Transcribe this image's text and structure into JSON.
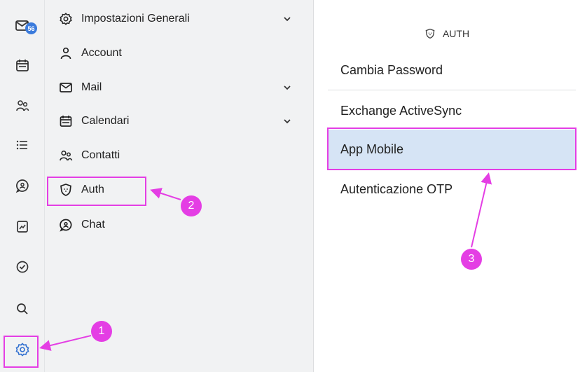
{
  "rail": {
    "badge_count": "56",
    "icons": [
      "mail-icon",
      "calendar-icon",
      "contacts-icon",
      "list-icon",
      "chat-icon",
      "files-icon",
      "tasks-icon",
      "search-icon",
      "settings-icon"
    ]
  },
  "menu": {
    "items": [
      {
        "label": "Impostazioni Generali",
        "icon": "gear-icon",
        "expandable": true
      },
      {
        "label": "Account",
        "icon": "person-icon",
        "expandable": false
      },
      {
        "label": "Mail",
        "icon": "mail-icon",
        "expandable": true
      },
      {
        "label": "Calendari",
        "icon": "calendar-icon",
        "expandable": true
      },
      {
        "label": "Contatti",
        "icon": "contacts-icon",
        "expandable": false
      },
      {
        "label": "Auth",
        "icon": "shield-icon",
        "expandable": false
      },
      {
        "label": "Chat",
        "icon": "chat-icon",
        "expandable": false
      }
    ]
  },
  "auth_panel": {
    "title": "AUTH",
    "options": [
      {
        "label": "Cambia Password",
        "selected": false
      },
      {
        "label": "Exchange ActiveSync",
        "selected": false
      },
      {
        "label": "App Mobile",
        "selected": true
      },
      {
        "label": "Autenticazione OTP",
        "selected": false
      }
    ]
  },
  "annotations": {
    "steps": [
      "1",
      "2",
      "3"
    ],
    "color": "#e43ee4"
  },
  "colors": {
    "selected_bg": "#d6e4f5",
    "rail_bg": "#f1f2f3",
    "badge": "#3b7bdc",
    "settings_active": "#2f6fd0"
  }
}
